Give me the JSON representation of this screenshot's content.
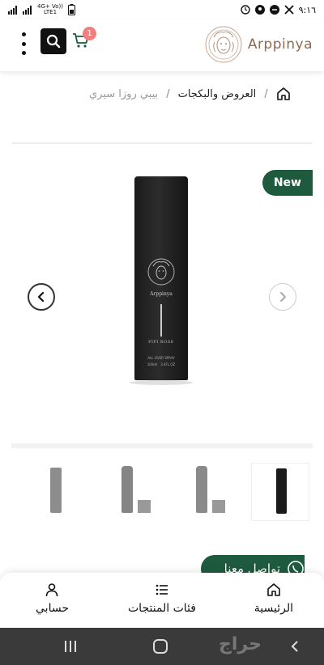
{
  "status_bar": {
    "time": "٩:١٦",
    "network_top": "4G+ Vo))",
    "network_bottom": "LTE1"
  },
  "header": {
    "logo_text": "Arppinya",
    "cart_count": "1"
  },
  "breadcrumb": {
    "home_icon": "home-icon",
    "items": [
      "العروض والبكجات",
      "بيبي روزا سيري"
    ],
    "separator": "/"
  },
  "product": {
    "badge": "New",
    "bottle_brand": "Arppinya",
    "bottle_name": "PIPI ROSE",
    "bottle_desc": "ALL OVER SPRAY",
    "bottle_volume": "100ml   3.4FL.OZ"
  },
  "thumbnails": {
    "count": 4,
    "selected_index": 0
  },
  "contact_fab": {
    "label": "تواصل معنا"
  },
  "bottom_nav": {
    "items": [
      {
        "label": "الرئيسية",
        "icon": "home-icon"
      },
      {
        "label": "فئات المنتجات",
        "icon": "list-icon"
      },
      {
        "label": "حسابي",
        "icon": "user-icon"
      }
    ]
  },
  "system_nav": {
    "watermark": "حراج"
  },
  "colors": {
    "brand_green": "#1e5a3e",
    "logo_brown": "#8c6a55",
    "cart_badge": "#f08080"
  }
}
